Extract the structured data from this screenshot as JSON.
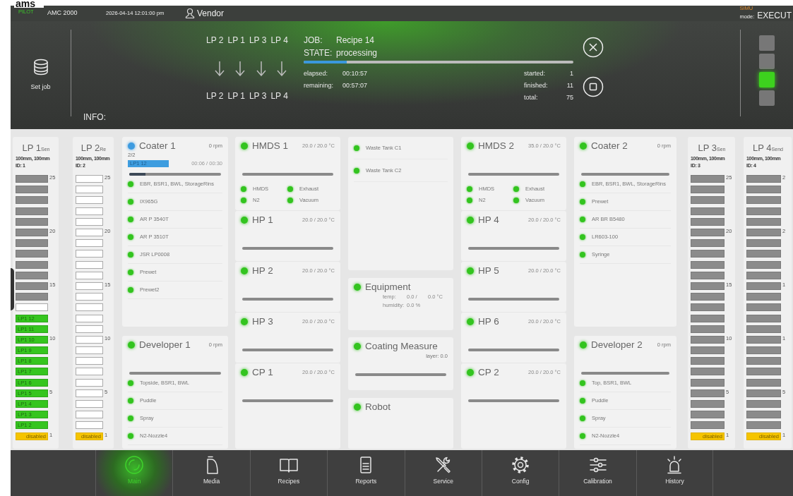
{
  "title_bar": {
    "logo": "ams",
    "logo_sub": "PILOT",
    "machine": "AMC 2000",
    "datetime": "2026-04-14 12:01:00 pm",
    "user": "Vendor",
    "sim_label": "SIMU",
    "mode_label": "mode:",
    "mode": "EXECUT"
  },
  "header": {
    "set_job": "Set job",
    "info_label": "INFO:",
    "route_from": [
      "LP 2",
      "LP 1",
      "LP 3",
      "LP 4"
    ],
    "route_to": [
      "LP 2",
      "LP 1",
      "LP 3",
      "LP 4"
    ],
    "job": {
      "job_label": "JOB:",
      "job": "Recipe 14",
      "state_label": "STATE:",
      "state": "processing",
      "level": 0.16,
      "times": [
        {
          "label": "elapsed:",
          "value": "00:10:57"
        },
        {
          "label": "remaining:",
          "value": "00:57:07"
        }
      ],
      "counts": [
        {
          "label": "started:",
          "value": "1"
        },
        {
          "label": "finished:",
          "value": "11"
        },
        {
          "label": "total:",
          "value": "75"
        }
      ]
    },
    "lights": [
      {
        "on": false
      },
      {
        "on": false
      },
      {
        "on": true
      },
      {
        "on": false
      }
    ]
  },
  "columns": [
    {
      "kind": "loadport",
      "name": "LP 1",
      "sub": "Sen",
      "size": "100mm, 100mm",
      "id": "ID: 1",
      "slots": [
        {
          "kind": "wafer",
          "number": "25"
        },
        {
          "kind": "wafer"
        },
        {
          "kind": "wafer"
        },
        {
          "kind": "wafer"
        },
        {
          "kind": "wafer"
        },
        {
          "kind": "wafer",
          "number": "20"
        },
        {
          "kind": "wafer"
        },
        {
          "kind": "wafer"
        },
        {
          "kind": "wafer"
        },
        {
          "kind": "wafer"
        },
        {
          "kind": "wafer",
          "number": "15"
        },
        {
          "kind": "wafer"
        },
        {
          "kind": "empty"
        },
        {
          "kind": "done",
          "text": "LP1 12"
        },
        {
          "kind": "done",
          "text": "LP1 11"
        },
        {
          "kind": "done",
          "text": "LP1 10",
          "number": "10"
        },
        {
          "kind": "done",
          "text": "LP1 9"
        },
        {
          "kind": "done",
          "text": "LP1 8"
        },
        {
          "kind": "done",
          "text": "LP1 7"
        },
        {
          "kind": "done",
          "text": "LP1 6"
        },
        {
          "kind": "done",
          "text": "LP1 5",
          "number": "5"
        },
        {
          "kind": "done",
          "text": "LP1 4"
        },
        {
          "kind": "done",
          "text": "LP1 3"
        },
        {
          "kind": "done",
          "text": "LP1 2"
        },
        {
          "kind": "disabled",
          "text": "disabled",
          "number": "1"
        }
      ]
    },
    {
      "kind": "loadport",
      "name": "LP 2",
      "sub": "Re",
      "size": "100mm, 100mm",
      "id": "ID: 2",
      "slots": [
        {
          "kind": "empty",
          "number": "25"
        },
        {
          "kind": "empty"
        },
        {
          "kind": "empty"
        },
        {
          "kind": "empty"
        },
        {
          "kind": "empty"
        },
        {
          "kind": "empty",
          "number": "20"
        },
        {
          "kind": "empty"
        },
        {
          "kind": "empty"
        },
        {
          "kind": "empty"
        },
        {
          "kind": "empty"
        },
        {
          "kind": "empty",
          "number": "15"
        },
        {
          "kind": "empty"
        },
        {
          "kind": "empty"
        },
        {
          "kind": "empty"
        },
        {
          "kind": "empty"
        },
        {
          "kind": "empty",
          "number": "10"
        },
        {
          "kind": "empty"
        },
        {
          "kind": "empty"
        },
        {
          "kind": "empty"
        },
        {
          "kind": "empty"
        },
        {
          "kind": "empty",
          "number": "5"
        },
        {
          "kind": "empty"
        },
        {
          "kind": "empty"
        },
        {
          "kind": "empty"
        },
        {
          "kind": "disabled",
          "text": "disabled",
          "number": "1"
        }
      ]
    },
    {
      "kind": "stack",
      "cards": [
        {
          "kind": "module",
          "name": "Coater 1",
          "color": "#3d9be0",
          "speed": "0 rpm",
          "count": "2/2",
          "tag": "LP1 12",
          "time": "00:06 / 00:30",
          "level": 0.18,
          "items": [
            "EBR, BSR1, BWL, StorageRins",
            "IX965G",
            "AR P 3540T",
            "AR P 3510T",
            "JSR LP0008",
            "Prewet",
            "Prewet2"
          ]
        },
        {
          "kind": "module",
          "name": "Developer 1",
          "color": "#33c41f",
          "speed": "0 rpm",
          "bar": true,
          "items": [
            "Topside, BSR1, BWL",
            "Puddle",
            "Spray",
            "N2-Nozzle4"
          ]
        }
      ]
    },
    {
      "kind": "stack",
      "cards": [
        {
          "kind": "module",
          "name": "HMDS 1",
          "color": "#33c41f",
          "reading": "20.0 / 20.0 °C",
          "bar": true,
          "flags": [
            "HMDS",
            "Exhaust",
            "N2",
            "Vacuum"
          ]
        },
        {
          "kind": "module",
          "name": "HP 1",
          "color": "#33c41f",
          "reading": "20.0 / 20.0 °C",
          "bar": true
        },
        {
          "kind": "module",
          "name": "HP 2",
          "color": "#33c41f",
          "reading": "20.0 / 20.0 °C",
          "bar": true
        },
        {
          "kind": "module",
          "name": "HP 3",
          "color": "#33c41f",
          "reading": "20.0 / 20.0 °C",
          "bar": true
        },
        {
          "kind": "module",
          "name": "CP 1",
          "color": "#33c41f",
          "reading": "20.0 / 20.0 °C",
          "bar": true
        }
      ]
    },
    {
      "kind": "stack",
      "cards": [
        {
          "kind": "tanks",
          "items": [
            "Waste Tank C1",
            "Waste Tank C2"
          ]
        },
        {
          "kind": "module",
          "name": "Equipment",
          "color": "#33c41f",
          "rows": [
            {
              "label": "temp:",
              "values": [
                "0.0 /",
                "0.0 °C"
              ]
            },
            {
              "label": "humidity:",
              "values": [
                "0.0 %"
              ]
            }
          ]
        },
        {
          "kind": "module",
          "name": "Coating Measure",
          "color": "#33c41f",
          "note": "layer: 0.0",
          "bar": true
        },
        {
          "kind": "module",
          "name": "Robot",
          "color": "#33c41f"
        }
      ]
    },
    {
      "kind": "stack",
      "cards": [
        {
          "kind": "module",
          "name": "HMDS 2",
          "color": "#33c41f",
          "reading": "35.0 / 20.0 °C",
          "bar": true,
          "flags": [
            "HMDS",
            "Exhaust",
            "N2",
            "Vacuum"
          ]
        },
        {
          "kind": "module",
          "name": "HP 4",
          "color": "#33c41f",
          "reading": "20.0 / 20.0 °C",
          "bar": true
        },
        {
          "kind": "module",
          "name": "HP 5",
          "color": "#33c41f",
          "reading": "20.0 / 20.0 °C",
          "bar": true
        },
        {
          "kind": "module",
          "name": "HP 6",
          "color": "#33c41f",
          "reading": "20.0 / 20.0 °C",
          "bar": true
        },
        {
          "kind": "module",
          "name": "CP 2",
          "color": "#33c41f",
          "reading": "20.0 / 20.0 °C",
          "bar": true
        }
      ]
    },
    {
      "kind": "stack",
      "cards": [
        {
          "kind": "module",
          "name": "Coater 2",
          "color": "#33c41f",
          "speed": "0 rpm",
          "bar": true,
          "items": [
            "EBR, BSR1, BWL, StorageRins",
            "Prewet",
            "AR BR B5480",
            "LR603-100",
            "Syringe"
          ]
        },
        {
          "kind": "module",
          "name": "Developer 2",
          "color": "#33c41f",
          "speed": "0 rpm",
          "bar": true,
          "items": [
            "Top, BSR1, BWL",
            "Puddle",
            "Spray",
            "N2-Nozzle4"
          ]
        }
      ]
    },
    {
      "kind": "loadport",
      "name": "LP 3",
      "sub": "Sen",
      "size": "100mm, 100mm",
      "id": "ID: 3",
      "slots": [
        {
          "kind": "wafer",
          "number": "25"
        },
        {
          "kind": "wafer"
        },
        {
          "kind": "wafer"
        },
        {
          "kind": "wafer"
        },
        {
          "kind": "wafer"
        },
        {
          "kind": "wafer",
          "number": "20"
        },
        {
          "kind": "wafer"
        },
        {
          "kind": "wafer"
        },
        {
          "kind": "wafer"
        },
        {
          "kind": "wafer"
        },
        {
          "kind": "wafer",
          "number": "15"
        },
        {
          "kind": "wafer"
        },
        {
          "kind": "wafer"
        },
        {
          "kind": "wafer"
        },
        {
          "kind": "wafer"
        },
        {
          "kind": "wafer",
          "number": "10"
        },
        {
          "kind": "wafer"
        },
        {
          "kind": "wafer"
        },
        {
          "kind": "wafer"
        },
        {
          "kind": "wafer"
        },
        {
          "kind": "wafer",
          "number": "5"
        },
        {
          "kind": "wafer"
        },
        {
          "kind": "wafer"
        },
        {
          "kind": "wafer"
        },
        {
          "kind": "disabled",
          "text": "disabled",
          "number": "1"
        }
      ]
    },
    {
      "kind": "loadport",
      "name": "LP 4",
      "sub": "Send",
      "size": "100mm, 100mm",
      "id": "ID: 4",
      "slots": [
        {
          "kind": "wafer",
          "number": "2"
        },
        {
          "kind": "wafer"
        },
        {
          "kind": "wafer"
        },
        {
          "kind": "wafer"
        },
        {
          "kind": "wafer"
        },
        {
          "kind": "wafer",
          "number": "2"
        },
        {
          "kind": "wafer"
        },
        {
          "kind": "wafer"
        },
        {
          "kind": "wafer"
        },
        {
          "kind": "wafer"
        },
        {
          "kind": "wafer",
          "number": "1"
        },
        {
          "kind": "wafer"
        },
        {
          "kind": "wafer"
        },
        {
          "kind": "wafer"
        },
        {
          "kind": "wafer"
        },
        {
          "kind": "wafer",
          "number": "1"
        },
        {
          "kind": "wafer"
        },
        {
          "kind": "wafer"
        },
        {
          "kind": "wafer"
        },
        {
          "kind": "wafer"
        },
        {
          "kind": "wafer",
          "number": "5"
        },
        {
          "kind": "wafer"
        },
        {
          "kind": "wafer"
        },
        {
          "kind": "wafer"
        },
        {
          "kind": "disabled",
          "text": "disabled",
          "number": "1"
        }
      ]
    }
  ],
  "nav": [
    {
      "label": "Main",
      "selected": true
    },
    {
      "label": "Media",
      "selected": false
    },
    {
      "label": "Recipes",
      "selected": false
    },
    {
      "label": "Reports",
      "selected": false
    },
    {
      "label": "Service",
      "selected": false
    },
    {
      "label": "Config",
      "selected": false
    },
    {
      "label": "Calibration",
      "selected": false
    },
    {
      "label": "History",
      "selected": false
    }
  ]
}
